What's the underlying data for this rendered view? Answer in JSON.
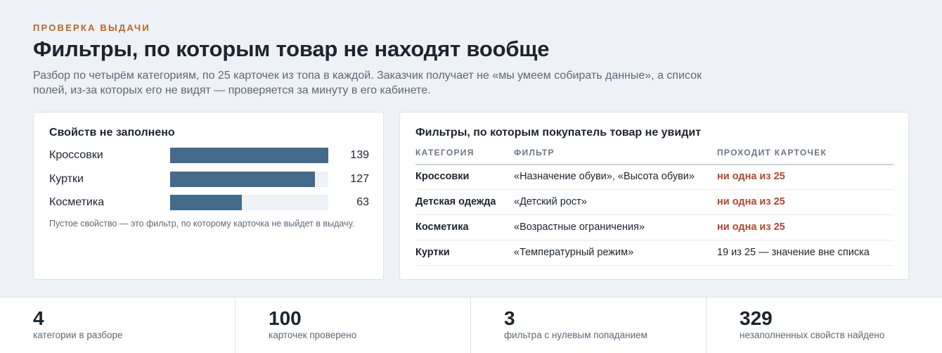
{
  "header": {
    "eyebrow": "ПРОВЕРКА ВЫДАЧИ",
    "title": "Фильтры, по которым товар не находят вообще",
    "subtitle": "Разбор по четырём категориям, по 25 карточек из топа в каждой. Заказчик получает не «мы умеем собирать данные», а список полей, из-за которых его не видят — проверяется за минуту в его кабинете."
  },
  "missing_props": {
    "title": "Свойств не заполнено",
    "note": "Пустое свойство — это фильтр, по которому карточка не выйдет в выдачу.",
    "max": 139,
    "bar_color": "#436a8b",
    "items": [
      {
        "label": "Кроссовки",
        "value": 139,
        "display": "139"
      },
      {
        "label": "Куртки",
        "value": 127,
        "display": "127"
      },
      {
        "label": "Косметика",
        "value": 63,
        "display": "63"
      }
    ]
  },
  "filters_table": {
    "title": "Фильтры, по которым покупатель товар не увидит",
    "headers": {
      "category": "КАТЕГОРИЯ",
      "filter": "ФИЛЬТР",
      "result": "ПРОХОДИТ КАРТОЧЕК"
    },
    "alert_color": "#b0472f",
    "rows": [
      {
        "category": "Кроссовки",
        "filter": "«Назначение обуви», «Высота обуви»",
        "result": "ни одна из 25",
        "zero": true
      },
      {
        "category": "Детская одежда",
        "filter": "«Детский рост»",
        "result": "ни одна из 25",
        "zero": true
      },
      {
        "category": "Косметика",
        "filter": "«Возрастные ограничения»",
        "result": "ни одна из 25",
        "zero": true
      },
      {
        "category": "Куртки",
        "filter": "«Температурный режим»",
        "result": "19 из 25 — значение вне списка",
        "zero": false
      }
    ]
  },
  "stats": [
    {
      "value": "4",
      "label": "категории в разборе"
    },
    {
      "value": "100",
      "label": "карточек проверено"
    },
    {
      "value": "3",
      "label": "фильтра с нулевым попаданием"
    },
    {
      "value": "329",
      "label": "незаполненных свойств найдено"
    }
  ],
  "colors": {
    "accent": "#b8662a",
    "background": "#eef1f5"
  }
}
